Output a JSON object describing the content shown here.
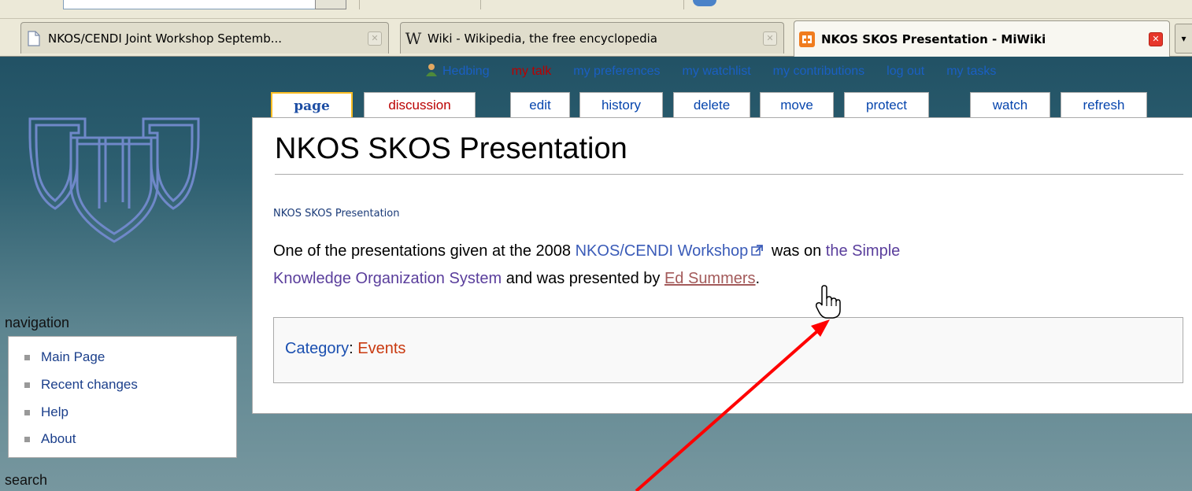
{
  "browser": {
    "tabs": [
      {
        "title": "NKOS/CENDI Joint Workshop Septemb...",
        "icon": "document-icon",
        "active": false
      },
      {
        "title": "Wiki - Wikipedia, the free encyclopedia",
        "icon": "wikipedia-icon",
        "active": false
      },
      {
        "title": "NKOS SKOS Presentation - MiWiki",
        "icon": "miwiki-icon",
        "active": true
      }
    ],
    "tab_close_glyph": "✕",
    "overflow_glyph": "▾"
  },
  "personal_tools": {
    "user": "Hedbing",
    "talk": "my talk",
    "preferences": "my preferences",
    "watchlist": "my watchlist",
    "contributions": "my contributions",
    "logout": "log out",
    "tasks": "my tasks"
  },
  "content_tabs": {
    "page": "page",
    "discussion": "discussion",
    "edit": "edit",
    "history": "history",
    "delete": "delete",
    "move": "move",
    "protect": "protect",
    "watch": "watch",
    "refresh": "refresh"
  },
  "page": {
    "title": "NKOS SKOS Presentation",
    "site_sub": "NKOS SKOS Presentation",
    "body": {
      "part1": "One of the presentations given at the 2008 ",
      "link_workshop": "NKOS/CENDI Workshop",
      "part2": " was on ",
      "link_skos_1": "the Simple",
      "link_skos_2": "Knowledge Organization System",
      "part3": " and was presented by ",
      "link_person": "Ed Summers",
      "part4": "."
    },
    "category_label": "Category",
    "category_sep": ": ",
    "category_value": "Events"
  },
  "sidebar": {
    "navigation_title": "navigation",
    "items": [
      {
        "label": "Main Page"
      },
      {
        "label": "Recent changes"
      },
      {
        "label": "Help"
      },
      {
        "label": "About"
      }
    ],
    "search_title": "search"
  },
  "colors": {
    "annotation_arrow": "#ff0000",
    "link_blue": "#0645ad",
    "new_link_red": "#ba0000",
    "visited_purple": "#5a3e9c",
    "tab_selected_border": "#fabd23"
  }
}
